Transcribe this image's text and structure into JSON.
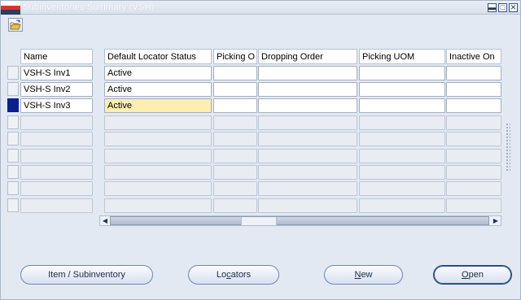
{
  "window": {
    "title": "Subinventories Summary (VSH)",
    "controls": {
      "minimize": "▬",
      "maximize": "□",
      "close": "✕"
    }
  },
  "toolbar": {
    "open_icon": "folder-open-icon"
  },
  "columns": [
    "Name",
    "Default Locator Status",
    "Picking O",
    "Dropping Order",
    "Picking UOM",
    "Inactive On"
  ],
  "rows": [
    {
      "name": "VSH-S Inv1",
      "status": "Active",
      "picking_order": "",
      "dropping_order": "",
      "picking_uom": "",
      "inactive_on": ""
    },
    {
      "name": "VSH-S Inv2",
      "status": "Active",
      "picking_order": "",
      "dropping_order": "",
      "picking_uom": "",
      "inactive_on": ""
    },
    {
      "name": "VSH-S Inv3",
      "status": "Active",
      "picking_order": "",
      "dropping_order": "",
      "picking_uom": "",
      "inactive_on": ""
    }
  ],
  "current_row_index": 3,
  "colors": {
    "current_field": "#fdeeb2",
    "record_indicator": "#0b1f8c",
    "window_bg": "#e3e9f2"
  },
  "scrollbar": {
    "left": "◀",
    "right": "▶"
  },
  "buttons": {
    "item_subinventory": "Item / Subinventory",
    "locators_pre": "Lo",
    "locators_mn": "c",
    "locators_post": "ators",
    "new_mn": "N",
    "new_post": "ew",
    "open_mn": "O",
    "open_post": "pen"
  }
}
